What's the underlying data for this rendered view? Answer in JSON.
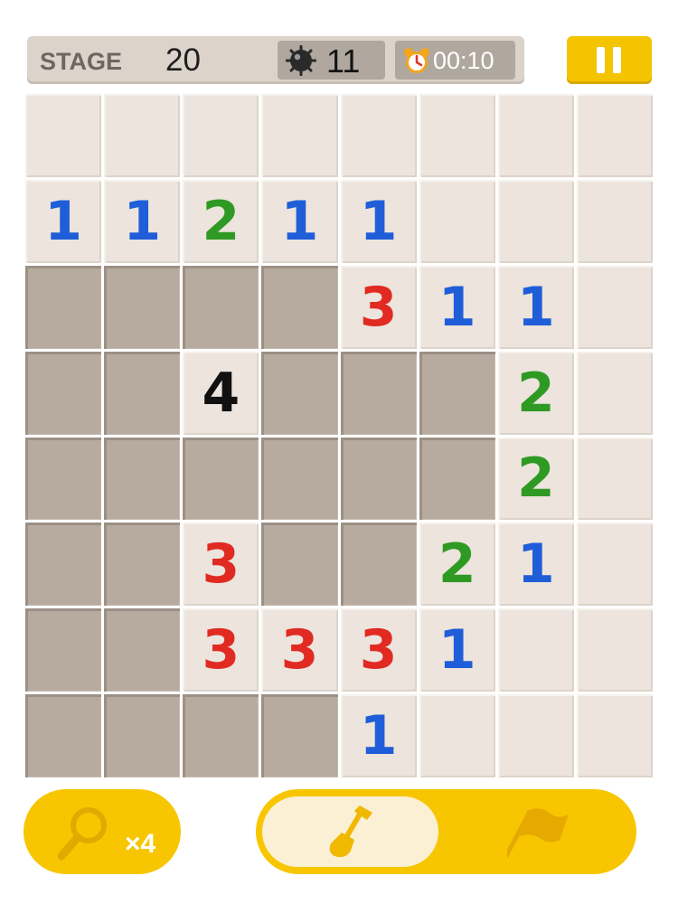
{
  "header": {
    "stage_label": "STAGE",
    "stage_number": "20",
    "mines_remaining": "11",
    "timer": "00:10"
  },
  "board": {
    "rows": [
      [
        {
          "state": "open",
          "n": ""
        },
        {
          "state": "open",
          "n": ""
        },
        {
          "state": "open",
          "n": ""
        },
        {
          "state": "open",
          "n": ""
        },
        {
          "state": "open",
          "n": ""
        },
        {
          "state": "open",
          "n": ""
        },
        {
          "state": "open",
          "n": ""
        },
        {
          "state": "open",
          "n": ""
        }
      ],
      [
        {
          "state": "open",
          "n": "1"
        },
        {
          "state": "open",
          "n": "1"
        },
        {
          "state": "open",
          "n": "2"
        },
        {
          "state": "open",
          "n": "1"
        },
        {
          "state": "open",
          "n": "1"
        },
        {
          "state": "open",
          "n": ""
        },
        {
          "state": "open",
          "n": ""
        },
        {
          "state": "open",
          "n": ""
        }
      ],
      [
        {
          "state": "covered",
          "n": ""
        },
        {
          "state": "covered",
          "n": ""
        },
        {
          "state": "covered",
          "n": ""
        },
        {
          "state": "covered",
          "n": ""
        },
        {
          "state": "open",
          "n": "3"
        },
        {
          "state": "open",
          "n": "1"
        },
        {
          "state": "open",
          "n": "1"
        },
        {
          "state": "open",
          "n": ""
        }
      ],
      [
        {
          "state": "covered",
          "n": ""
        },
        {
          "state": "covered",
          "n": ""
        },
        {
          "state": "open",
          "n": "4"
        },
        {
          "state": "covered",
          "n": ""
        },
        {
          "state": "covered",
          "n": ""
        },
        {
          "state": "covered",
          "n": ""
        },
        {
          "state": "open",
          "n": "2"
        },
        {
          "state": "open",
          "n": ""
        }
      ],
      [
        {
          "state": "covered",
          "n": ""
        },
        {
          "state": "covered",
          "n": ""
        },
        {
          "state": "covered",
          "n": ""
        },
        {
          "state": "covered",
          "n": ""
        },
        {
          "state": "covered",
          "n": ""
        },
        {
          "state": "covered",
          "n": ""
        },
        {
          "state": "open",
          "n": "2"
        },
        {
          "state": "open",
          "n": ""
        }
      ],
      [
        {
          "state": "covered",
          "n": ""
        },
        {
          "state": "covered",
          "n": ""
        },
        {
          "state": "open",
          "n": "3"
        },
        {
          "state": "covered",
          "n": ""
        },
        {
          "state": "covered",
          "n": ""
        },
        {
          "state": "open",
          "n": "2"
        },
        {
          "state": "open",
          "n": "1"
        },
        {
          "state": "open",
          "n": ""
        }
      ],
      [
        {
          "state": "covered",
          "n": ""
        },
        {
          "state": "covered",
          "n": ""
        },
        {
          "state": "open",
          "n": "3"
        },
        {
          "state": "open",
          "n": "3"
        },
        {
          "state": "open",
          "n": "3"
        },
        {
          "state": "open",
          "n": "1"
        },
        {
          "state": "open",
          "n": ""
        },
        {
          "state": "open",
          "n": ""
        }
      ],
      [
        {
          "state": "covered",
          "n": ""
        },
        {
          "state": "covered",
          "n": ""
        },
        {
          "state": "covered",
          "n": ""
        },
        {
          "state": "covered",
          "n": ""
        },
        {
          "state": "open",
          "n": "1"
        },
        {
          "state": "open",
          "n": ""
        },
        {
          "state": "open",
          "n": ""
        },
        {
          "state": "open",
          "n": ""
        }
      ]
    ]
  },
  "controls": {
    "hint_count": "×4",
    "active_mode": "dig",
    "icons": {
      "mine": "mine-icon",
      "clock": "alarm-clock-icon",
      "pause": "pause-icon",
      "hint": "magnifier-icon",
      "dig": "shovel-icon",
      "flag": "flag-icon"
    }
  },
  "colors": {
    "accent": "#f7c600",
    "number_1": "#1f5ed8",
    "number_2": "#2f9a23",
    "number_3": "#e02a22",
    "number_4": "#111111"
  }
}
